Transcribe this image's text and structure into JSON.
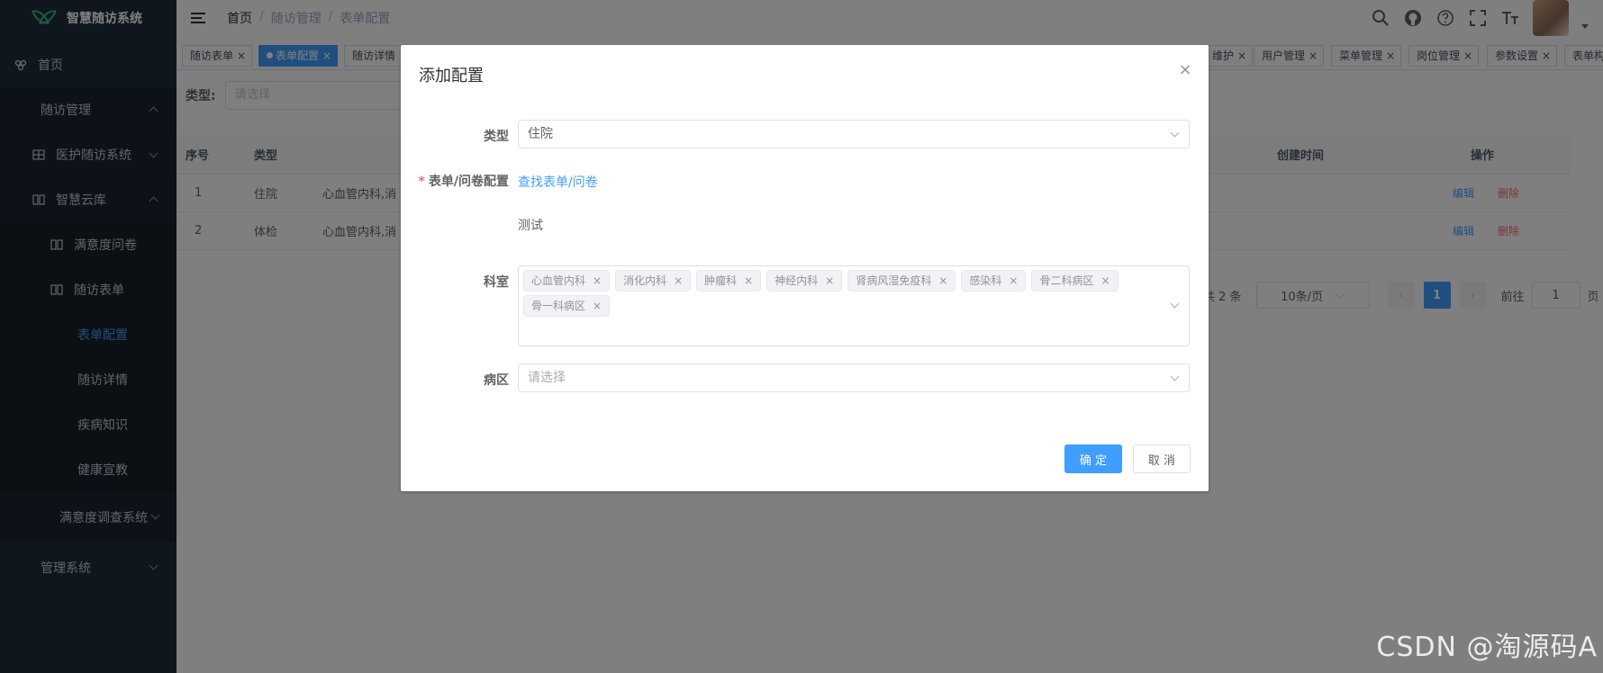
{
  "app": {
    "title": "智慧随访系统"
  },
  "sidebar": {
    "items": [
      {
        "label": "首页"
      },
      {
        "label": "随访管理"
      },
      {
        "label": "医护随访系统"
      },
      {
        "label": "智慧云库"
      },
      {
        "label": "满意度问卷"
      },
      {
        "label": "随访表单"
      },
      {
        "label": "表单配置"
      },
      {
        "label": "随访详情"
      },
      {
        "label": "疾病知识"
      },
      {
        "label": "健康宣教"
      },
      {
        "label": "满意度调查系统"
      },
      {
        "label": "管理系统"
      }
    ]
  },
  "breadcrumb": {
    "home": "首页",
    "level2": "随访管理",
    "level3": "表单配置",
    "sep": "/"
  },
  "tags": [
    {
      "label": "随访表单"
    },
    {
      "label": "表单配置"
    },
    {
      "label": "随访详情"
    },
    {
      "label": "维护"
    },
    {
      "label": "用户管理"
    },
    {
      "label": "菜单管理"
    },
    {
      "label": "岗位管理"
    },
    {
      "label": "参数设置"
    },
    {
      "label": "表单构"
    }
  ],
  "filter": {
    "label": "类型:",
    "placeholder": "请选择"
  },
  "table": {
    "headers": {
      "index": "序号",
      "type": "类型",
      "created": "创建时间",
      "actions": "操作"
    },
    "rows": [
      {
        "index": "1",
        "type": "住院",
        "dept": "心血管内科,消",
        "edit": "编辑",
        "delete": "删除"
      },
      {
        "index": "2",
        "type": "体检",
        "dept": "心血管内科,消",
        "edit": "编辑",
        "delete": "删除"
      }
    ]
  },
  "pagination": {
    "total": "共 2 条",
    "page_size": "10条/页",
    "current": "1",
    "goto_label": "前往",
    "goto_value": "1",
    "page_suffix": "页"
  },
  "dialog": {
    "title": "添加配置",
    "type_label": "类型",
    "type_value": "住院",
    "form_label": "表单/问卷配置",
    "find_link": "查找表单/问卷",
    "form_value": "测试",
    "dept_label": "科室",
    "depts": [
      "心血管内科",
      "消化内科",
      "肿瘤科",
      "神经内科",
      "肾病风湿免疫科",
      "感染科",
      "骨二科病区",
      "骨一科病区"
    ],
    "ward_label": "病区",
    "ward_placeholder": "请选择",
    "confirm": "确 定",
    "cancel": "取 消"
  },
  "watermark": "CSDN @淘源码A",
  "colors": {
    "primary": "#409eff",
    "danger": "#f56c6c",
    "sidebar": "#1f2d3d"
  }
}
